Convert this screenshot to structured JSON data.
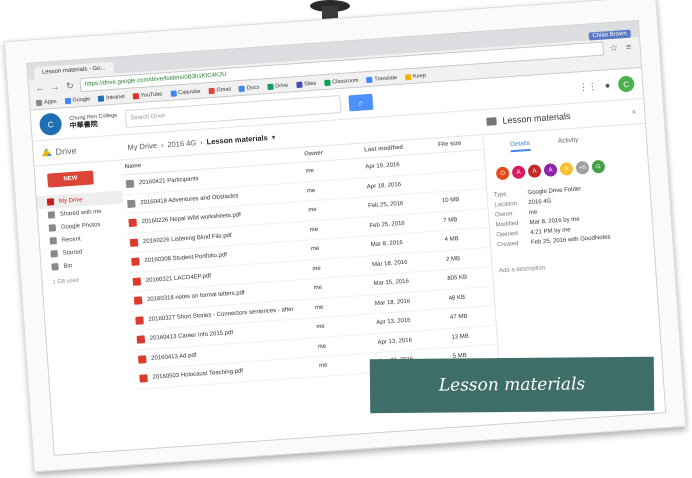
{
  "browser": {
    "tab_title": "Lesson materials - Go...",
    "user_chip": "Chiao Brown",
    "url": "https://drive.google.com/drive/folders/0B3h1KfC4K2U",
    "bookmarks": [
      "Apps",
      "Google",
      "Intranet",
      "YouTube",
      "Calendar",
      "Gmail",
      "Docs",
      "Drive",
      "Sites",
      "Classroom",
      "Translate",
      "Keep"
    ]
  },
  "drive": {
    "school_name_en": "Chung Ren College",
    "school_name_zh": "中華書院",
    "search_placeholder": "Search Drive",
    "brand": "Drive",
    "new_label": "NEW",
    "breadcrumb": [
      "My Drive",
      "2016 4G",
      "Lesson materials"
    ],
    "sidebar": [
      "My Drive",
      "Shared with me",
      "Google Photos",
      "Recent",
      "Starred",
      "Bin"
    ],
    "storage": "1 GB used",
    "columns": {
      "name": "Name",
      "owner": "Owner",
      "modified": "Last modified",
      "size": "File size"
    },
    "files": [
      {
        "name": "20160421 Participants",
        "type": "folder",
        "owner": "me",
        "modified": "Apr 19, 2016",
        "size": ""
      },
      {
        "name": "20160418 Adventures and Obstacles",
        "type": "folder",
        "owner": "me",
        "modified": "Apr 18, 2016",
        "size": ""
      },
      {
        "name": "20160226 Nepal Wild worksheets.pdf",
        "type": "pdf",
        "owner": "me",
        "modified": "Feb 25, 2016",
        "size": "10 MB"
      },
      {
        "name": "20160226 Listening Blind File.pdf",
        "type": "pdf",
        "owner": "me",
        "modified": "Feb 25, 2016",
        "size": "7 MB"
      },
      {
        "name": "20160308 Student Portfolio.pdf",
        "type": "pdf",
        "owner": "me",
        "modified": "Mar 8, 2016",
        "size": "4 MB"
      },
      {
        "name": "20160321 LACO4EP.pdf",
        "type": "pdf",
        "owner": "me",
        "modified": "Mar 18, 2016",
        "size": "2 MB"
      },
      {
        "name": "20160318 notes on formal letters.pdf",
        "type": "pdf",
        "owner": "me",
        "modified": "Mar 15, 2016",
        "size": "805 KB"
      },
      {
        "name": "20160327 Short Stories - Connectors sentences - after",
        "type": "pdf",
        "owner": "me",
        "modified": "Mar 18, 2016",
        "size": "48 KB"
      },
      {
        "name": "20160413 Career Info 2015.pdf",
        "type": "pdf",
        "owner": "me",
        "modified": "Apr 13, 2016",
        "size": "47 MB"
      },
      {
        "name": "20160413 Ad.pdf",
        "type": "pdf",
        "owner": "me",
        "modified": "Apr 13, 2016",
        "size": "13 MB"
      },
      {
        "name": "20160503 Holocaust Teaching.pdf",
        "type": "pdf",
        "owner": "me",
        "modified": "Apr 23, 2016",
        "size": "5 MB"
      }
    ],
    "details": {
      "title": "Lesson materials",
      "tab_details": "Details",
      "tab_activity": "Activity",
      "who": [
        {
          "initial": "O",
          "color": "#e64a19"
        },
        {
          "initial": "A",
          "color": "#d81b60"
        },
        {
          "initial": "A",
          "color": "#c62828"
        },
        {
          "initial": "A",
          "color": "#8e24aa"
        },
        {
          "initial": "A",
          "color": "#fbc02d"
        },
        {
          "initial": "+5",
          "color": "#9e9e9e"
        },
        {
          "initial": "G",
          "color": "#43a047"
        }
      ],
      "fields": [
        {
          "k": "Type",
          "v": "Google Drive Folder"
        },
        {
          "k": "Location",
          "v": "2016 4G"
        },
        {
          "k": "Owner",
          "v": "me"
        },
        {
          "k": "Modified",
          "v": "Mar 8, 2016 by me"
        },
        {
          "k": "Opened",
          "v": "4:21 PM by me"
        },
        {
          "k": "Created",
          "v": "Feb 25, 2016 with GoodNotes"
        }
      ],
      "description": "Add a description"
    }
  },
  "caption": "Lesson materials"
}
